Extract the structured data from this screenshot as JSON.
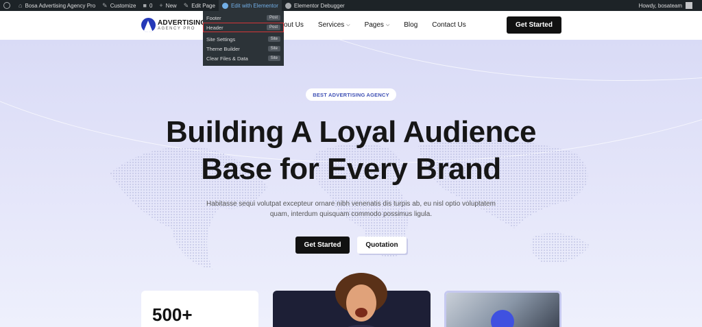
{
  "adminbar": {
    "site_name": "Bosa Advertising Agency Pro",
    "customize": "Customize",
    "comments_count": "0",
    "new": "New",
    "edit_page": "Edit Page",
    "edit_with_elementor": "Edit with Elementor",
    "elementor_debugger": "Elementor Debugger",
    "howdy": "Howdy, bosateam"
  },
  "dropdown": {
    "items": [
      {
        "label": "Footer",
        "tag": "Post"
      },
      {
        "label": "Header",
        "tag": "Post"
      },
      {
        "label": "Site Settings",
        "tag": "Site"
      },
      {
        "label": "Theme Builder",
        "tag": "Site"
      },
      {
        "label": "Clear Files & Data",
        "tag": "Site"
      }
    ]
  },
  "header": {
    "logo_line1": "ADVERTISING",
    "logo_line2": "AGENCY PRO",
    "nav": [
      "out Us",
      "Services",
      "Pages",
      "Blog",
      "Contact Us"
    ],
    "cta": "Get Started"
  },
  "hero": {
    "badge": "BEST ADVERTISING AGENCY",
    "headline_line1": "Building A Loyal Audience",
    "headline_line2": "Base for Every Brand",
    "subtext": "Habitasse sequi volutpat excepteur ornare nibh venenatis dis turpis ab, eu nisl optio voluptatem quam, interdum quisquam commodo possimus ligula.",
    "btn_primary": "Get Started",
    "btn_secondary": "Quotation"
  },
  "stats": {
    "count": "500+"
  },
  "colors": {
    "accent": "#3f51b5",
    "dark": "#111111",
    "admin_bar": "#1d2327"
  }
}
